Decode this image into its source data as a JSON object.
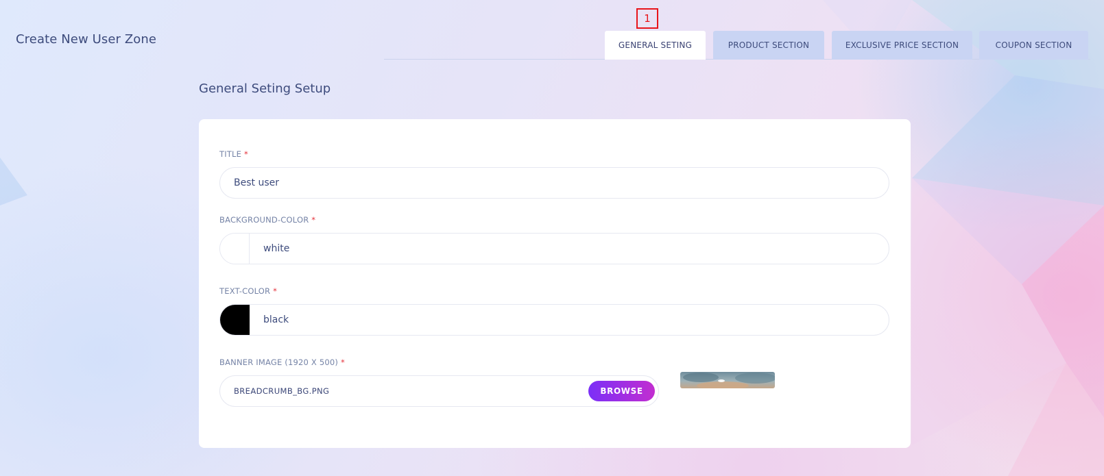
{
  "header": {
    "page_title": "Create New User Zone"
  },
  "tabs": [
    {
      "label": "GENERAL SETING",
      "active": true
    },
    {
      "label": "PRODUCT SECTION",
      "active": false
    },
    {
      "label": "EXCLUSIVE PRICE SECTION",
      "active": false
    },
    {
      "label": "COUPON SECTION",
      "active": false
    }
  ],
  "marker": {
    "label": "1"
  },
  "section": {
    "title": "General Seting Setup"
  },
  "form": {
    "required_mark": "*",
    "title": {
      "label": "TITLE",
      "value": "Best user"
    },
    "background_color": {
      "label": "BACKGROUND-COLOR",
      "value": "white",
      "swatch": "#ffffff"
    },
    "text_color": {
      "label": "TEXT-COLOR",
      "value": "black",
      "swatch": "#000000"
    },
    "banner_image": {
      "label": "BANNER IMAGE (1920 X 500)",
      "file_name": "BREADCRUMB_BG.PNG",
      "browse_label": "BROWSE"
    }
  },
  "colors": {
    "accent_start": "#7b2ff7",
    "accent_end": "#c22ed0",
    "tab_inactive": "#c9d4f3",
    "required": "#e5323b",
    "marker": "#e8141a"
  }
}
